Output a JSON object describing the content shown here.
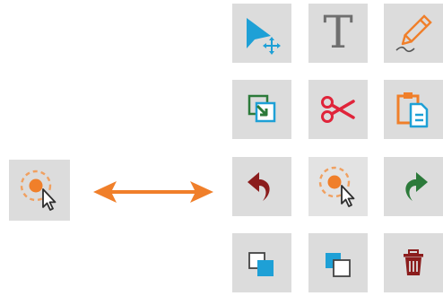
{
  "standalone_tool": {
    "icon": "click-target-cursor-icon"
  },
  "relation_arrow": {
    "icon": "double-headed-arrow-icon",
    "color": "#f07f2a"
  },
  "palette": {
    "tools": [
      {
        "name": "select-tool",
        "icon": "select-move-arrow-icon"
      },
      {
        "name": "text-tool",
        "icon": "text-tool-icon",
        "glyph": "T"
      },
      {
        "name": "draw-tool",
        "icon": "pencil-icon"
      },
      {
        "name": "copy-tool",
        "icon": "copy-icon"
      },
      {
        "name": "cut-tool",
        "icon": "scissors-icon"
      },
      {
        "name": "paste-tool",
        "icon": "paste-clipboard-icon"
      },
      {
        "name": "undo-tool",
        "icon": "undo-icon"
      },
      {
        "name": "click-tool",
        "icon": "click-target-cursor-icon",
        "active": true
      },
      {
        "name": "redo-tool",
        "icon": "redo-icon"
      },
      {
        "name": "bring-to-front-tool",
        "icon": "bring-to-front-icon"
      },
      {
        "name": "send-to-back-tool",
        "icon": "send-to-back-icon"
      },
      {
        "name": "delete-tool",
        "icon": "trash-icon"
      }
    ]
  },
  "colors": {
    "tile": "#dcdcdc",
    "blue_accent": "#1ea0d6",
    "orange_accent": "#f07f2a",
    "red_accent": "#e0243a",
    "dark_red": "#8b1d1d",
    "green_accent": "#2c7a3a"
  }
}
